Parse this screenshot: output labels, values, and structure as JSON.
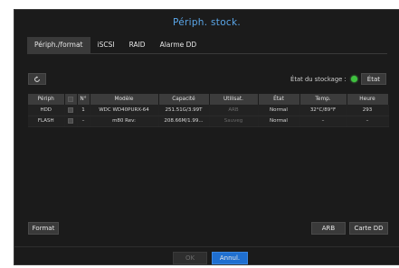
{
  "title": "Périph. stock.",
  "tabs": [
    {
      "label": "Périph./format"
    },
    {
      "label": "iSCSI"
    },
    {
      "label": "RAID"
    },
    {
      "label": "Alarme DD"
    }
  ],
  "status": {
    "label": "État du stockage :",
    "button": "État",
    "indicator_color": "#3ec23e"
  },
  "table": {
    "headers": [
      "Périph",
      "",
      "N°",
      "Modèle",
      "Capacité",
      "Utilisat.",
      "État",
      "Temp.",
      "Heure"
    ],
    "rows": [
      {
        "device": "HDD",
        "num": "1",
        "model": "WDC WD40PURX-64",
        "capacity": "251.51G/3.99T",
        "usage": "ARB",
        "state": "Normal",
        "temp": "32°C/89°F",
        "hours": "293"
      },
      {
        "device": "FLASH",
        "num": "–",
        "model": "m80 Rev:",
        "capacity": "208.66M/1.99...",
        "usage": "Sauveg",
        "state": "Normal",
        "temp": "–",
        "hours": "–"
      }
    ]
  },
  "buttons": {
    "format": "Format",
    "arb": "ARB",
    "carte_dd": "Carte DD",
    "ok": "OK",
    "cancel": "Annul."
  }
}
